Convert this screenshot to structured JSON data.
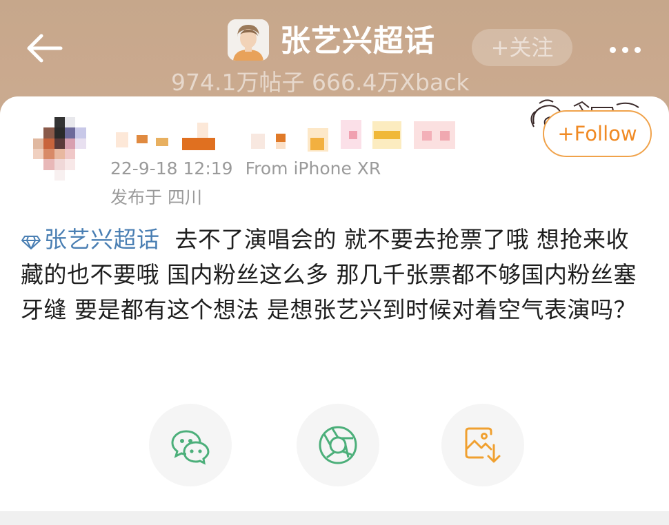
{
  "header": {
    "title": "张艺兴超话",
    "follow_label": "+关注",
    "stats": "974.1万帖子 666.4万Xback"
  },
  "post": {
    "author_name_visible": "",
    "timestamp": "22-9-18 12:19",
    "source": "From iPhone XR",
    "location": "发布于 四川",
    "follow_label": "+Follow",
    "topic": "张艺兴超话",
    "body": "去不了演唱会的 就不要去抢票了哦 想抢来收藏的也不要哦 国内粉丝这么多 那几千张票都不够国内粉丝塞牙缝 要是都有这个想法 是想张艺兴到时候对着空气表演吗？"
  },
  "share": {
    "items": [
      {
        "icon": "wechat-icon"
      },
      {
        "icon": "moments-icon"
      },
      {
        "icon": "save-image-icon"
      }
    ]
  },
  "colors": {
    "header_bg": "#c8a88a",
    "accent_orange": "#f08a24",
    "topic_blue": "#4a7fb3",
    "icon_green": "#4caf7a"
  }
}
